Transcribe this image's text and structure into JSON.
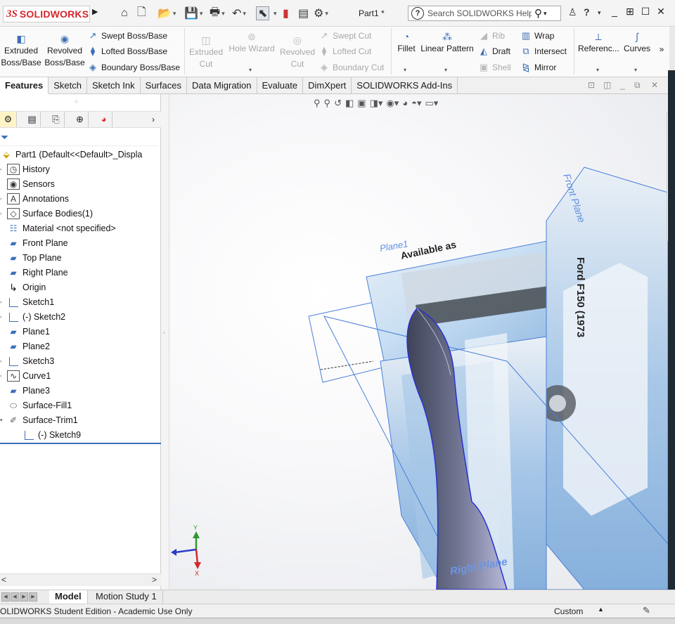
{
  "app": {
    "brand_ds": "3S",
    "brand_name": "SOLIDWORKS",
    "doc_title": "Part1 *"
  },
  "search": {
    "placeholder": "Search SOLIDWORKS Help"
  },
  "ribbon": {
    "extruded_boss": "Extruded\nBoss/Base",
    "revolved_boss": "Revolved\nBoss/Base",
    "swept_boss": "Swept Boss/Base",
    "lofted_boss": "Lofted Boss/Base",
    "boundary_boss": "Boundary Boss/Base",
    "extruded_cut": "Extruded\nCut",
    "hole_wizard": "Hole Wizard",
    "revolved_cut": "Revolved\nCut",
    "swept_cut": "Swept Cut",
    "lofted_cut": "Lofted Cut",
    "boundary_cut": "Boundary Cut",
    "fillet": "Fillet",
    "linear_pattern": "Linear Pattern",
    "rib": "Rib",
    "draft": "Draft",
    "shell": "Shell",
    "wrap": "Wrap",
    "intersect": "Intersect",
    "mirror": "Mirror",
    "reference": "Referenc...",
    "curves": "Curves",
    "more": "»"
  },
  "tabs": [
    "Features",
    "Sketch",
    "Sketch Ink",
    "Surfaces",
    "Data Migration",
    "Evaluate",
    "DimXpert",
    "SOLIDWORKS Add-Ins"
  ],
  "tree": {
    "root": "Part1  (Default<<Default>_Displa",
    "items": [
      {
        "label": "History",
        "icon": "history-icon"
      },
      {
        "label": "Sensors",
        "icon": "sensors-icon"
      },
      {
        "label": "Annotations",
        "icon": "annotations-icon"
      },
      {
        "label": "Surface Bodies(1)",
        "icon": "surface-bodies-icon"
      },
      {
        "label": "Material <not specified>",
        "icon": "material-icon"
      },
      {
        "label": "Front Plane",
        "icon": "plane-icon"
      },
      {
        "label": "Top Plane",
        "icon": "plane-icon"
      },
      {
        "label": "Right Plane",
        "icon": "plane-icon"
      },
      {
        "label": "Origin",
        "icon": "origin-icon"
      },
      {
        "label": "Sketch1",
        "icon": "sketch-icon"
      },
      {
        "label": "(-) Sketch2",
        "icon": "sketch-icon"
      },
      {
        "label": "Plane1",
        "icon": "plane-icon"
      },
      {
        "label": "Plane2",
        "icon": "plane-icon"
      },
      {
        "label": "Sketch3",
        "icon": "sketch-icon"
      },
      {
        "label": "Curve1",
        "icon": "curve-icon"
      },
      {
        "label": "Plane3",
        "icon": "plane-icon"
      },
      {
        "label": "Surface-Fill1",
        "icon": "surface-fill-icon"
      },
      {
        "label": "Surface-Trim1",
        "icon": "surface-trim-icon"
      },
      {
        "label": "(-) Sketch9",
        "icon": "sketch-icon"
      }
    ]
  },
  "viewport": {
    "front_plane_label": "Front Plane",
    "right_plane_label": "Right Plane",
    "plane_label": "Plane1",
    "decal_text": "Available as",
    "decal_side_text": "Ford F150 (1973",
    "axis_x": "X",
    "axis_y": "Y",
    "axis_z": "Z"
  },
  "bottom_tabs": [
    "Model",
    "Motion Study 1"
  ],
  "status": {
    "left": "OLIDWORKS Student Edition - Academic Use Only",
    "units": "Custom"
  },
  "colors": {
    "brand_red": "#d4262c",
    "plane_blue": "#4a7fd8",
    "icon_blue": "#3c6fb8"
  }
}
